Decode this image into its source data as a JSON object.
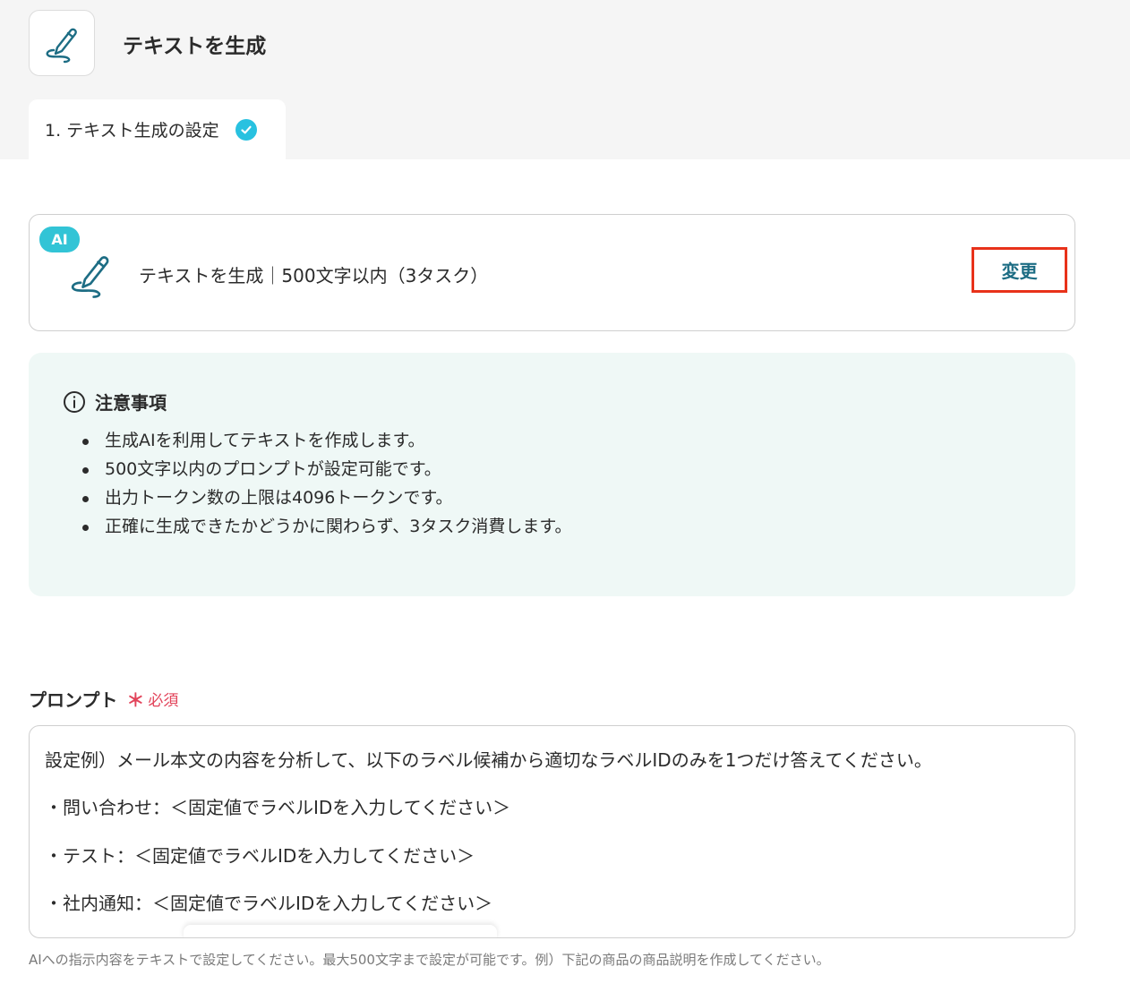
{
  "header": {
    "title": "テキストを生成",
    "icon": "pen-icon"
  },
  "tabs": [
    {
      "label": "1. テキスト生成の設定",
      "status_icon": "check-circle-icon",
      "completed": true
    }
  ],
  "action_card": {
    "badge": "AI",
    "icon": "pen-icon",
    "label": "テキストを生成｜500文字以内（3タスク）",
    "change_button": "変更"
  },
  "notice": {
    "icon": "info-icon",
    "title": "注意事項",
    "items": [
      "生成AIを利用してテキストを作成します。",
      "500文字以内のプロンプトが設定可能です。",
      "出力トークン数の上限は4096トークンです。",
      "正確に生成できたかどうかに関わらず、3タスク消費します。"
    ]
  },
  "prompt": {
    "label": "プロンプト",
    "required_mark": "＊",
    "required_text": "必須",
    "lines": [
      "設定例）メール本文の内容を分析して、以下のラベル候補から適切なラベルIDのみを1つだけ答えてください。",
      "・問い合わせ：＜固定値でラベルIDを入力してください＞",
      "・テスト：＜固定値でラベルIDを入力してください＞",
      "・社内通知：＜固定値でラベルIDを入力してください＞"
    ],
    "helper": "AIへの指示内容をテキストで設定してください。最大500文字まで設定が可能です。例）下記の商品の商品説明を作成してください。"
  },
  "colors": {
    "accent": "#1d6d84",
    "badge": "#32c4d6",
    "highlight_border": "#e8321a",
    "required": "#e2435a",
    "notice_bg": "#eff8f6"
  }
}
